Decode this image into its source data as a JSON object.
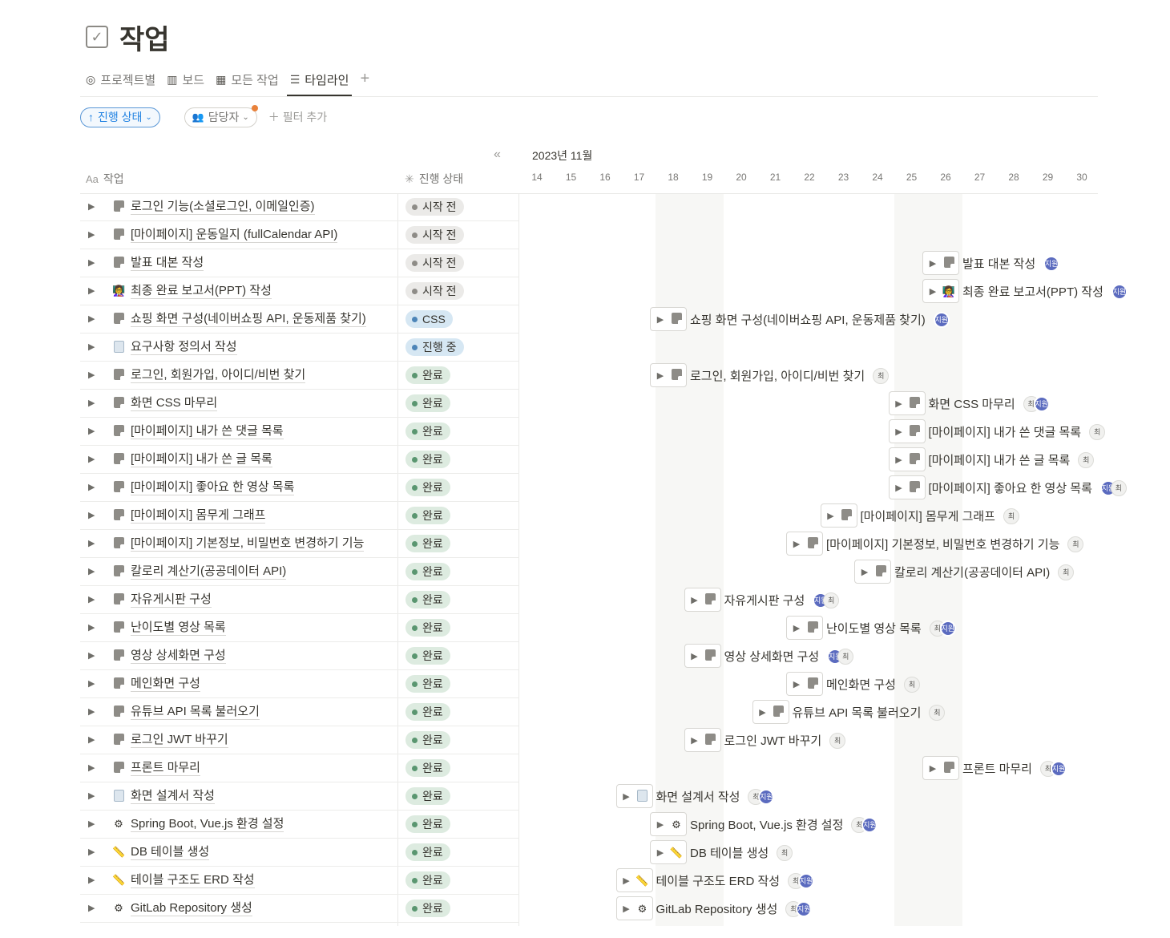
{
  "page": {
    "title": "작업",
    "title_icon": "checkbox-icon"
  },
  "tabs": [
    {
      "label": "프로젝트별",
      "icon": "target-icon",
      "active": false
    },
    {
      "label": "보드",
      "icon": "board-icon",
      "active": false
    },
    {
      "label": "모든 작업",
      "icon": "table-icon",
      "active": false
    },
    {
      "label": "타임라인",
      "icon": "timeline-icon",
      "active": true
    }
  ],
  "tab_add": "+",
  "filters": {
    "sort_label": "진행 상태",
    "person_label": "담당자",
    "add_filter_label": "필터 추가"
  },
  "timeline": {
    "month_label": "2023년 11월",
    "days": [
      "14",
      "15",
      "16",
      "17",
      "18",
      "19",
      "20",
      "21",
      "22",
      "23",
      "24",
      "25",
      "26",
      "27",
      "28",
      "29",
      "30"
    ]
  },
  "columns": {
    "task": "작업",
    "status": "진행 상태"
  },
  "colors": {
    "accent": "#2383e2",
    "avatar_ji": "#5b6bbf",
    "status_gray": "#ebeae8",
    "status_blue": "#d6e7f3",
    "status_green": "#ddebe0"
  },
  "rows": [
    {
      "name": "로그인 기능(소셜로그인, 이메일인증)",
      "icon": "doc-icon",
      "status": "시작 전",
      "status_color": "gray"
    },
    {
      "name": "[마이페이지] 운동일지 (fullCalendar API)",
      "icon": "doc-icon",
      "status": "시작 전",
      "status_color": "gray"
    },
    {
      "name": "발표 대본 작성",
      "icon": "doc-icon",
      "status": "시작 전",
      "status_color": "gray"
    },
    {
      "name": "최종 완료 보고서(PPT) 작성",
      "icon": "presenter-icon",
      "status": "시작 전",
      "status_color": "gray"
    },
    {
      "name": "쇼핑 화면 구성(네이버쇼핑 API, 운동제품 찾기)",
      "icon": "doc-icon",
      "status": "CSS",
      "status_color": "blue"
    },
    {
      "name": "요구사항 정의서 작성",
      "icon": "note-icon",
      "status": "진행 중",
      "status_color": "blue"
    },
    {
      "name": "로그인, 회원가입, 아이디/비번 찾기",
      "icon": "doc-icon",
      "status": "완료",
      "status_color": "green"
    },
    {
      "name": "화면 CSS 마무리",
      "icon": "doc-icon",
      "status": "완료",
      "status_color": "green"
    },
    {
      "name": "[마이페이지] 내가 쓴 댓글 목록",
      "icon": "doc-icon",
      "status": "완료",
      "status_color": "green"
    },
    {
      "name": "[마이페이지] 내가 쓴 글 목록",
      "icon": "doc-icon",
      "status": "완료",
      "status_color": "green"
    },
    {
      "name": "[마이페이지] 좋아요 한 영상 목록",
      "icon": "doc-icon",
      "status": "완료",
      "status_color": "green"
    },
    {
      "name": "[마이페이지] 몸무게 그래프",
      "icon": "doc-icon",
      "status": "완료",
      "status_color": "green"
    },
    {
      "name": "[마이페이지] 기본정보, 비밀번호 변경하기 기능",
      "icon": "doc-icon",
      "status": "완료",
      "status_color": "green"
    },
    {
      "name": "칼로리 계산기(공공데이터 API)",
      "icon": "doc-icon",
      "status": "완료",
      "status_color": "green"
    },
    {
      "name": "자유게시판 구성",
      "icon": "doc-icon",
      "status": "완료",
      "status_color": "green"
    },
    {
      "name": "난이도별 영상 목록",
      "icon": "doc-icon",
      "status": "완료",
      "status_color": "green"
    },
    {
      "name": "영상 상세화면 구성",
      "icon": "doc-icon",
      "status": "완료",
      "status_color": "green"
    },
    {
      "name": "메인화면 구성",
      "icon": "doc-icon",
      "status": "완료",
      "status_color": "green"
    },
    {
      "name": "유튜브 API 목록 불러오기",
      "icon": "doc-icon",
      "status": "완료",
      "status_color": "green"
    },
    {
      "name": "로그인 JWT 바꾸기",
      "icon": "doc-icon",
      "status": "완료",
      "status_color": "green"
    },
    {
      "name": "프론트 마무리",
      "icon": "doc-icon",
      "status": "완료",
      "status_color": "green"
    },
    {
      "name": "화면 설계서 작성",
      "icon": "note-icon",
      "status": "완료",
      "status_color": "green"
    },
    {
      "name": "Spring Boot, Vue.js 환경 설정",
      "icon": "gears-icon",
      "status": "완료",
      "status_color": "green"
    },
    {
      "name": "DB 테이블 생성",
      "icon": "ruler-icon",
      "status": "완료",
      "status_color": "green"
    },
    {
      "name": "테이블 구조도 ERD 작성",
      "icon": "ruler-icon",
      "status": "완료",
      "status_color": "green"
    },
    {
      "name": "GitLab Repository 생성",
      "icon": "gears-icon",
      "status": "완료",
      "status_color": "green"
    }
  ],
  "bars": [
    null,
    null,
    {
      "start_day": "24",
      "people": [
        "지원"
      ]
    },
    {
      "start_day": "24",
      "people": [
        "지원"
      ]
    },
    {
      "start_day": "16",
      "people": [
        "지원"
      ]
    },
    null,
    {
      "start_day": "16",
      "people": [
        "최"
      ]
    },
    {
      "start_day": "23",
      "people": [
        "최",
        "지원"
      ]
    },
    {
      "start_day": "23",
      "people": [
        "최"
      ]
    },
    {
      "start_day": "23",
      "people": [
        "최"
      ]
    },
    {
      "start_day": "23",
      "people": [
        "지원",
        "최"
      ]
    },
    {
      "start_day": "21",
      "people": [
        "최"
      ]
    },
    {
      "start_day": "20",
      "people": [
        "최"
      ]
    },
    {
      "start_day": "22",
      "people": [
        "최"
      ]
    },
    {
      "start_day": "17",
      "people": [
        "지원",
        "최"
      ]
    },
    {
      "start_day": "20",
      "people": [
        "최",
        "지원"
      ]
    },
    {
      "start_day": "17",
      "people": [
        "지원",
        "최"
      ]
    },
    {
      "start_day": "20",
      "people": [
        "최"
      ]
    },
    {
      "start_day": "19",
      "people": [
        "최"
      ]
    },
    {
      "start_day": "17",
      "people": [
        "최"
      ]
    },
    {
      "start_day": "24",
      "people": [
        "최",
        "지원"
      ]
    },
    {
      "start_day": "15",
      "people": [
        "최",
        "지원"
      ]
    },
    {
      "start_day": "16",
      "people": [
        "최",
        "지원"
      ]
    },
    {
      "start_day": "16",
      "people": [
        "최"
      ]
    },
    {
      "start_day": "15",
      "people": [
        "최",
        "지원"
      ]
    },
    {
      "start_day": "15",
      "people": [
        "최",
        "지원"
      ]
    }
  ]
}
